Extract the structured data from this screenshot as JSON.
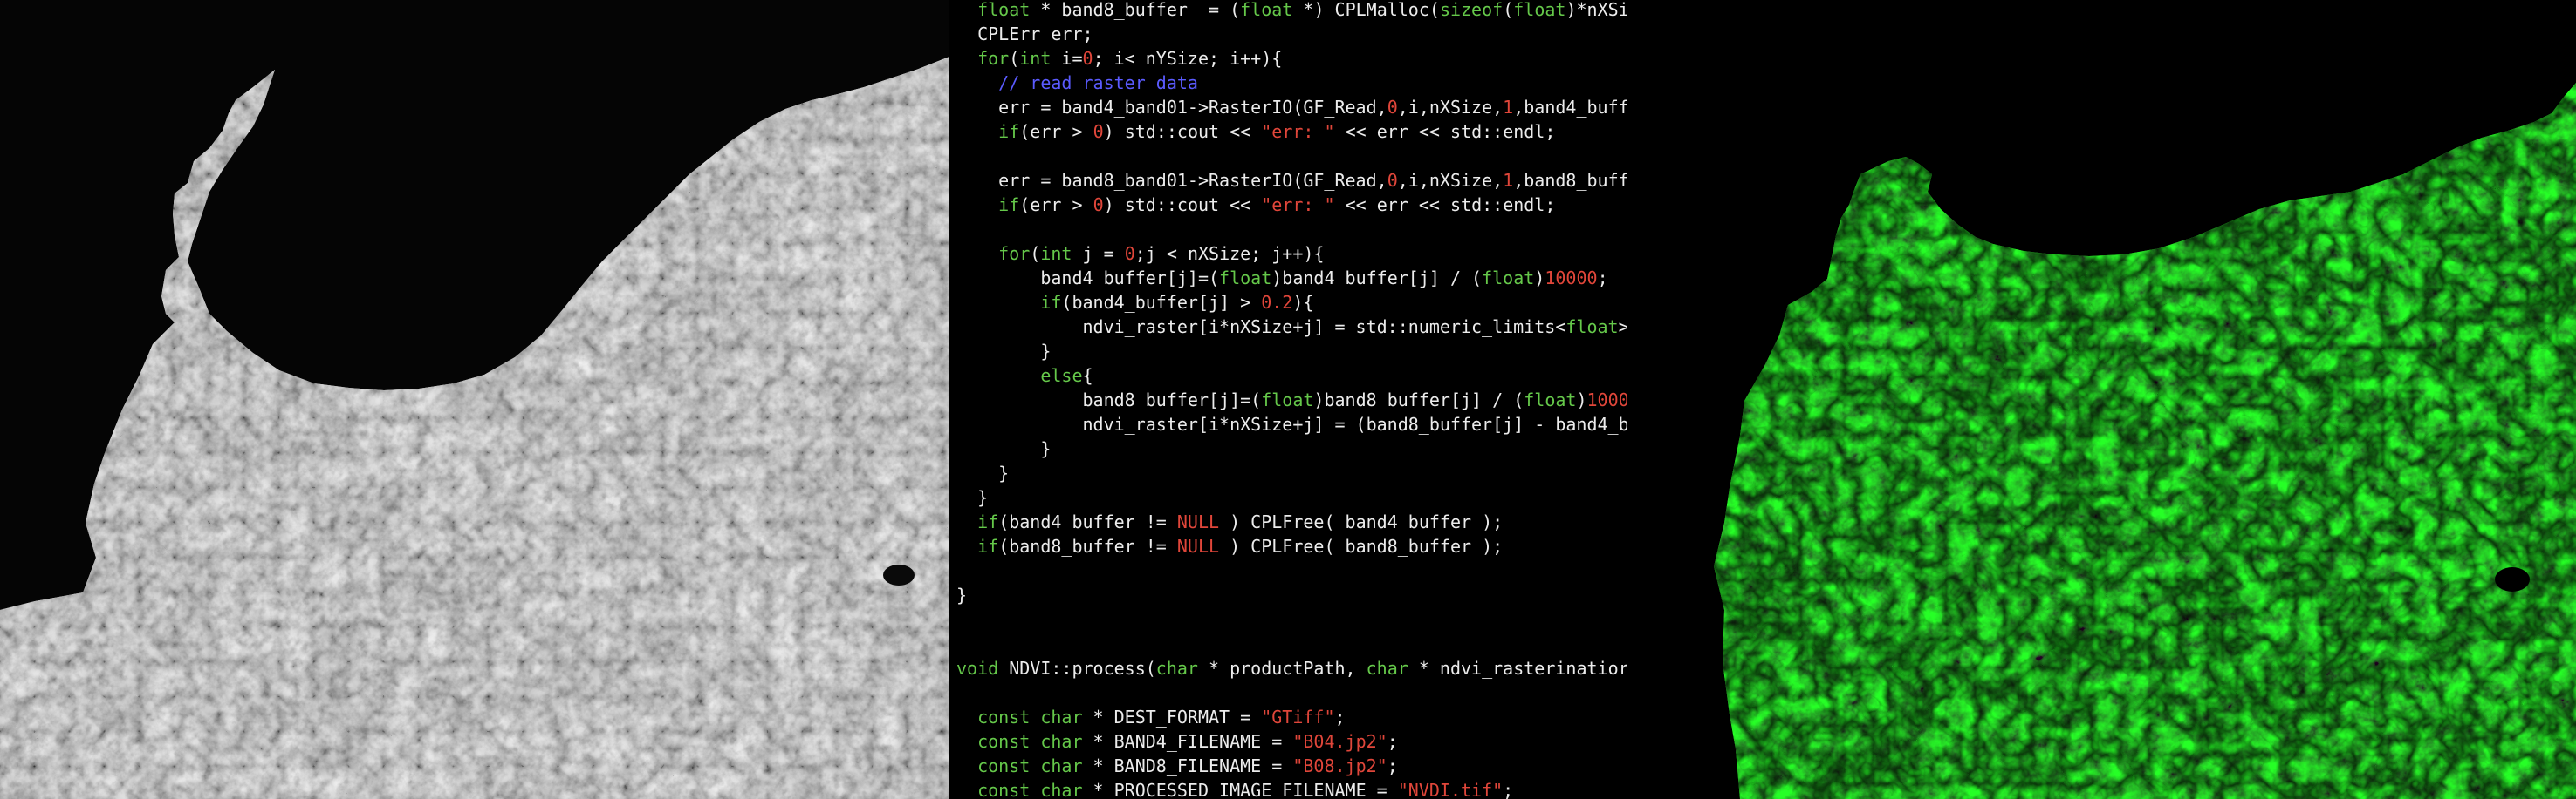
{
  "colors": {
    "keyword": "#65c84a",
    "number": "#e0463a",
    "string": "#e0463a",
    "comment": "#5b5bff",
    "plain": "#ececec",
    "ndvi_green": "#22c21f"
  },
  "left_image": {
    "name": "grayscale-satellite-image"
  },
  "right_image": {
    "name": "ndvi-green-satellite-image"
  },
  "code": {
    "lines": [
      [
        [
          "p",
          "  "
        ],
        [
          "kw",
          "float"
        ],
        [
          "p",
          " * band8_buffer  = ("
        ],
        [
          "kw",
          "float"
        ],
        [
          "p",
          " *) CPLMalloc("
        ],
        [
          "kw",
          "sizeof"
        ],
        [
          "p",
          "("
        ],
        [
          "kw",
          "float"
        ],
        [
          "p",
          ")*nXSi"
        ]
      ],
      [
        [
          "p",
          "  CPLErr err;"
        ]
      ],
      [
        [
          "p",
          "  "
        ],
        [
          "kw",
          "for"
        ],
        [
          "p",
          "("
        ],
        [
          "kw",
          "int"
        ],
        [
          "p",
          " i="
        ],
        [
          "num",
          "0"
        ],
        [
          "p",
          "; i< nYSize; i++){"
        ]
      ],
      [
        [
          "p",
          "    "
        ],
        [
          "cm",
          "// read raster data"
        ]
      ],
      [
        [
          "p",
          "    err = band4_band01->RasterIO(GF_Read,"
        ],
        [
          "num",
          "0"
        ],
        [
          "p",
          ",i,nXSize,"
        ],
        [
          "num",
          "1"
        ],
        [
          "p",
          ",band4_buff"
        ]
      ],
      [
        [
          "p",
          "    "
        ],
        [
          "kw",
          "if"
        ],
        [
          "p",
          "(err > "
        ],
        [
          "num",
          "0"
        ],
        [
          "p",
          ") std::cout << "
        ],
        [
          "str",
          "\"err: \""
        ],
        [
          "p",
          " << err << std::endl;"
        ]
      ],
      [
        [
          "p",
          ""
        ]
      ],
      [
        [
          "p",
          "    err = band8_band01->RasterIO(GF_Read,"
        ],
        [
          "num",
          "0"
        ],
        [
          "p",
          ",i,nXSize,"
        ],
        [
          "num",
          "1"
        ],
        [
          "p",
          ",band8_buff"
        ]
      ],
      [
        [
          "p",
          "    "
        ],
        [
          "kw",
          "if"
        ],
        [
          "p",
          "(err > "
        ],
        [
          "num",
          "0"
        ],
        [
          "p",
          ") std::cout << "
        ],
        [
          "str",
          "\"err: \""
        ],
        [
          "p",
          " << err << std::endl;"
        ]
      ],
      [
        [
          "p",
          ""
        ]
      ],
      [
        [
          "p",
          "    "
        ],
        [
          "kw",
          "for"
        ],
        [
          "p",
          "("
        ],
        [
          "kw",
          "int"
        ],
        [
          "p",
          " j = "
        ],
        [
          "num",
          "0"
        ],
        [
          "p",
          ";j < nXSize; j++){"
        ]
      ],
      [
        [
          "p",
          "        band4_buffer[j]=("
        ],
        [
          "kw",
          "float"
        ],
        [
          "p",
          ")band4_buffer[j] / ("
        ],
        [
          "kw",
          "float"
        ],
        [
          "p",
          ")"
        ],
        [
          "num",
          "10000"
        ],
        [
          "p",
          ";"
        ]
      ],
      [
        [
          "p",
          "        "
        ],
        [
          "kw",
          "if"
        ],
        [
          "p",
          "(band4_buffer[j] > "
        ],
        [
          "num",
          "0.2"
        ],
        [
          "p",
          "){"
        ]
      ],
      [
        [
          "p",
          "            ndvi_raster[i*nXSize+j] = std::numeric_limits<"
        ],
        [
          "kw",
          "float"
        ],
        [
          "p",
          ">"
        ]
      ],
      [
        [
          "p",
          "        }"
        ]
      ],
      [
        [
          "p",
          "        "
        ],
        [
          "kw",
          "else"
        ],
        [
          "p",
          "{"
        ]
      ],
      [
        [
          "p",
          "            band8_buffer[j]=("
        ],
        [
          "kw",
          "float"
        ],
        [
          "p",
          ")band8_buffer[j] / ("
        ],
        [
          "kw",
          "float"
        ],
        [
          "p",
          ")"
        ],
        [
          "num",
          "1000"
        ]
      ],
      [
        [
          "p",
          "            ndvi_raster[i*nXSize+j] = (band8_buffer[j] - band4_b"
        ]
      ],
      [
        [
          "p",
          "        }"
        ]
      ],
      [
        [
          "p",
          "    }"
        ]
      ],
      [
        [
          "p",
          "  }"
        ]
      ],
      [
        [
          "p",
          "  "
        ],
        [
          "kw",
          "if"
        ],
        [
          "p",
          "(band4_buffer != "
        ],
        [
          "num",
          "NULL"
        ],
        [
          "p",
          " ) CPLFree( band4_buffer );"
        ]
      ],
      [
        [
          "p",
          "  "
        ],
        [
          "kw",
          "if"
        ],
        [
          "p",
          "(band8_buffer != "
        ],
        [
          "num",
          "NULL"
        ],
        [
          "p",
          " ) CPLFree( band8_buffer );"
        ]
      ],
      [
        [
          "p",
          ""
        ]
      ],
      [
        [
          "p",
          "}"
        ]
      ],
      [
        [
          "p",
          ""
        ]
      ],
      [
        [
          "p",
          ""
        ]
      ],
      [
        [
          "kw",
          "void"
        ],
        [
          "p",
          " NDVI::process("
        ],
        [
          "kw",
          "char"
        ],
        [
          "p",
          " * productPath, "
        ],
        [
          "kw",
          "char"
        ],
        [
          "p",
          " * ndvi_rasterinatior"
        ]
      ],
      [
        [
          "p",
          ""
        ]
      ],
      [
        [
          "p",
          "  "
        ],
        [
          "kw",
          "const char"
        ],
        [
          "p",
          " * DEST_FORMAT = "
        ],
        [
          "str",
          "\"GTiff\""
        ],
        [
          "p",
          ";"
        ]
      ],
      [
        [
          "p",
          "  "
        ],
        [
          "kw",
          "const char"
        ],
        [
          "p",
          " * BAND4_FILENAME = "
        ],
        [
          "str",
          "\"B04.jp2\""
        ],
        [
          "p",
          ";"
        ]
      ],
      [
        [
          "p",
          "  "
        ],
        [
          "kw",
          "const char"
        ],
        [
          "p",
          " * BAND8_FILENAME = "
        ],
        [
          "str",
          "\"B08.jp2\""
        ],
        [
          "p",
          ";"
        ]
      ],
      [
        [
          "p",
          "  "
        ],
        [
          "kw",
          "const char"
        ],
        [
          "p",
          " * PROCESSED_IMAGE_FILENAME = "
        ],
        [
          "str",
          "\"NVDI.tif\""
        ],
        [
          "p",
          ";"
        ]
      ]
    ]
  }
}
